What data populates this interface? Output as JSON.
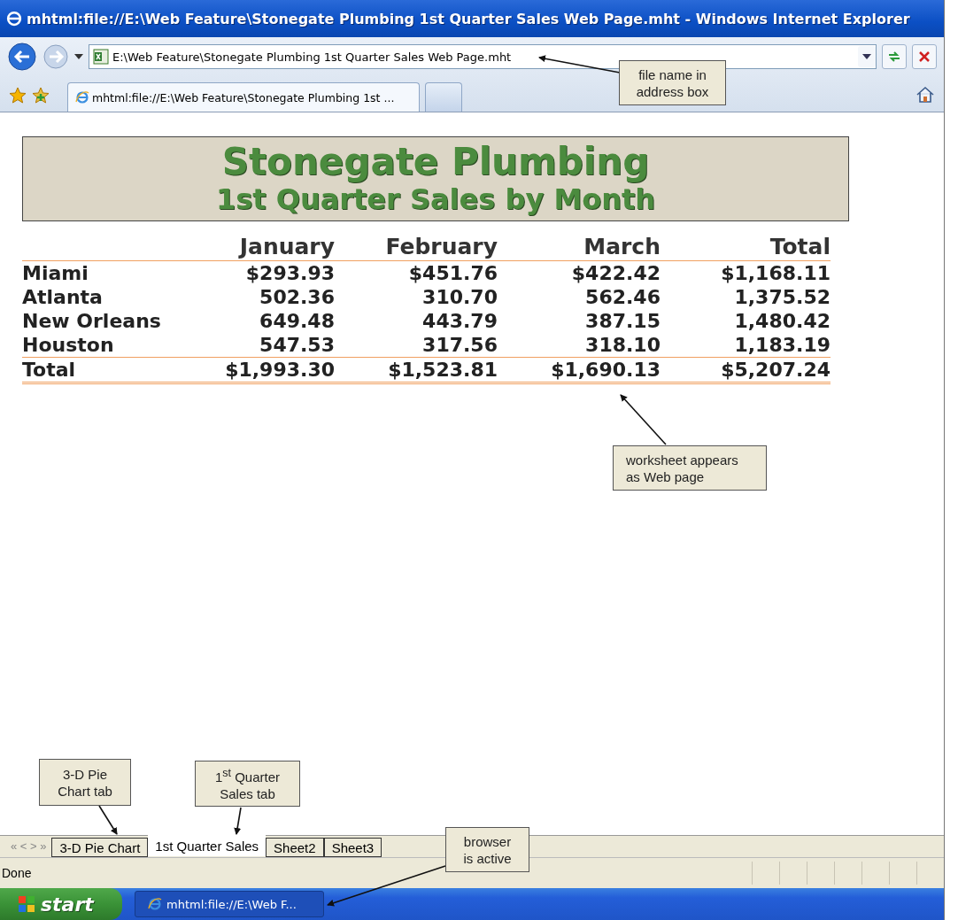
{
  "window": {
    "title": "mhtml:file://E:\\Web Feature\\Stonegate Plumbing 1st Quarter Sales Web Page.mht - Windows Internet Explorer"
  },
  "address_bar": {
    "value": "E:\\Web Feature\\Stonegate Plumbing 1st Quarter Sales Web Page.mht"
  },
  "browser_tabs": [
    {
      "label": "mhtml:file://E:\\Web Feature\\Stonegate Plumbing 1st ...",
      "selected": true
    },
    {
      "selected": false
    }
  ],
  "page": {
    "title": "Stonegate Plumbing",
    "subtitle": "1st Quarter Sales by Month",
    "columns": [
      "",
      "January",
      "February",
      "March",
      "Total"
    ],
    "rows": [
      [
        "Miami",
        "$293.93",
        "$451.76",
        "$422.42",
        "$1,168.11"
      ],
      [
        "Atlanta",
        "502.36",
        "310.70",
        "562.46",
        "1,375.52"
      ],
      [
        "New Orleans",
        "649.48",
        "443.79",
        "387.15",
        "1,480.42"
      ],
      [
        "Houston",
        "547.53",
        "317.56",
        "318.10",
        "1,183.19"
      ]
    ],
    "total_row": [
      "Total",
      "$1,993.30",
      "$1,523.81",
      "$1,690.13",
      "$5,207.24"
    ]
  },
  "sheet_nav": "« < > »",
  "sheet_tabs": [
    {
      "label": "3-D Pie Chart",
      "selected": false
    },
    {
      "label": "1st Quarter Sales",
      "selected": true
    },
    {
      "label": "Sheet2",
      "selected": false
    },
    {
      "label": "Sheet3",
      "selected": false
    }
  ],
  "status_bar": {
    "text": "Done"
  },
  "taskbar": {
    "start": "start",
    "task": "mhtml:file://E:\\Web F..."
  },
  "callouts": [
    {
      "text": "file name in address box"
    },
    {
      "text": "worksheet appears as Web page"
    },
    {
      "text": "3-D Pie Chart tab"
    },
    {
      "text": "1$^{st}$ Quarter Sales tab"
    },
    {
      "text": "browser is active"
    }
  ]
}
